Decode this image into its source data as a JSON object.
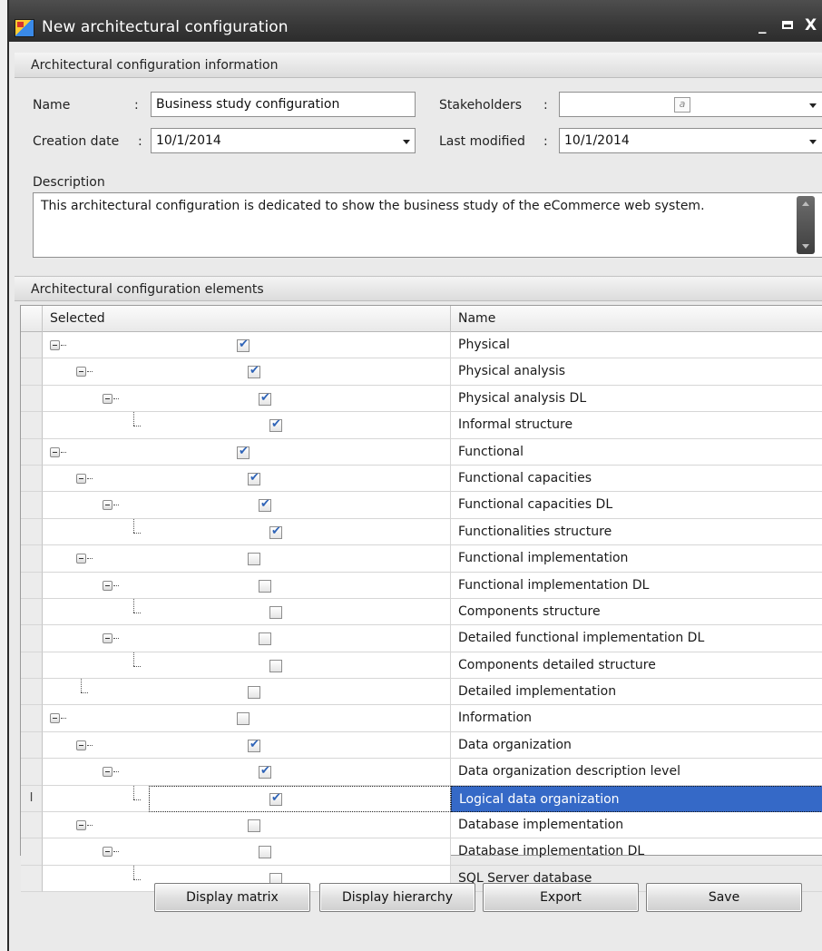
{
  "window": {
    "title": "New architectural configuration",
    "minimize": "_",
    "close": "X"
  },
  "info_section": {
    "title": "Architectural configuration information",
    "name_label": "Name",
    "name_value": "Business study configuration",
    "stakeholders_label": "Stakeholders",
    "stakeholders_value": "",
    "stakeholders_hint": "a",
    "creation_date_label": "Creation date",
    "creation_date_value": "10/1/2014",
    "last_modified_label": "Last modified",
    "last_modified_value": "10/1/2014",
    "colon": ":",
    "description_label": "Description",
    "description_value": "This architectural configuration is dedicated to show the business study of the eCommerce web system."
  },
  "elements_section": {
    "title": "Architectural configuration elements",
    "columns": {
      "selected": "Selected",
      "name": "Name"
    },
    "rows": [
      {
        "name": "Physical",
        "level": 0,
        "checked": true,
        "toggle": true,
        "last": false
      },
      {
        "name": "Physical analysis",
        "level": 1,
        "checked": true,
        "toggle": true,
        "last": false
      },
      {
        "name": "Physical analysis DL",
        "level": 2,
        "checked": true,
        "toggle": true,
        "last": false
      },
      {
        "name": "Informal structure",
        "level": 3,
        "checked": true,
        "toggle": false,
        "last": true
      },
      {
        "name": "Functional",
        "level": 0,
        "checked": true,
        "toggle": true,
        "last": false
      },
      {
        "name": "Functional capacities",
        "level": 1,
        "checked": true,
        "toggle": true,
        "last": false
      },
      {
        "name": "Functional capacities DL",
        "level": 2,
        "checked": true,
        "toggle": true,
        "last": false
      },
      {
        "name": "Functionalities structure",
        "level": 3,
        "checked": true,
        "toggle": false,
        "last": true
      },
      {
        "name": "Functional implementation",
        "level": 1,
        "checked": false,
        "toggle": true,
        "last": false
      },
      {
        "name": "Functional implementation DL",
        "level": 2,
        "checked": false,
        "toggle": true,
        "last": false
      },
      {
        "name": "Components structure",
        "level": 3,
        "checked": false,
        "toggle": false,
        "last": true
      },
      {
        "name": "Detailed functional implementation DL",
        "level": 2,
        "checked": false,
        "toggle": true,
        "last": false
      },
      {
        "name": "Components detailed structure",
        "level": 3,
        "checked": false,
        "toggle": false,
        "last": true
      },
      {
        "name": "Detailed implementation",
        "level": 1,
        "checked": false,
        "toggle": false,
        "last": true
      },
      {
        "name": "Information",
        "level": 0,
        "checked": false,
        "toggle": true,
        "last": false
      },
      {
        "name": "Data organization",
        "level": 1,
        "checked": true,
        "toggle": true,
        "last": false
      },
      {
        "name": "Data organization description level",
        "level": 2,
        "checked": true,
        "toggle": true,
        "last": false
      },
      {
        "name": "Logical data organization",
        "level": 3,
        "checked": true,
        "toggle": false,
        "last": true,
        "active": true
      },
      {
        "name": "Database implementation",
        "level": 1,
        "checked": false,
        "toggle": true,
        "last": false
      },
      {
        "name": "Database implementation DL",
        "level": 2,
        "checked": false,
        "toggle": true,
        "last": false
      },
      {
        "name": "SQL Server database",
        "level": 3,
        "checked": false,
        "toggle": false,
        "last": true
      }
    ],
    "active_row_marker": "I"
  },
  "buttons": {
    "display_matrix": "Display matrix",
    "display_hierarchy": "Display hierarchy",
    "export": "Export",
    "save": "Save"
  },
  "colors": {
    "selection": "#3569c7",
    "checkmark": "#2f64b8",
    "titlebar": "#383838"
  }
}
